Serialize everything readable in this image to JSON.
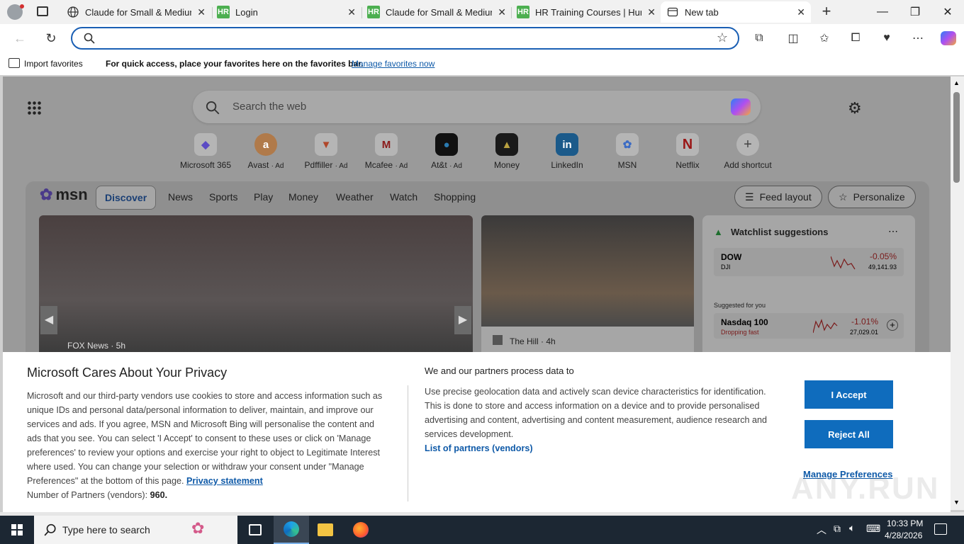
{
  "tabs": [
    {
      "title": "Claude for Small & Medium",
      "favicon": "globe-icon"
    },
    {
      "title": "Login",
      "favicon": "HR"
    },
    {
      "title": "Claude for Small & Medium",
      "favicon": "HR"
    },
    {
      "title": "HR Training Courses | Huma",
      "favicon": "HR"
    },
    {
      "title": "New tab",
      "favicon": "newtab-icon"
    }
  ],
  "address": {
    "value": "",
    "placeholder": ""
  },
  "favbar": {
    "import": "Import favorites",
    "message": "For quick access, place your favorites here on the favorites bar.",
    "manage_link": "Manage favorites now"
  },
  "newtab": {
    "search_placeholder": "Search the web",
    "shortcuts": [
      {
        "label": "Microsoft 365",
        "ad": ""
      },
      {
        "label": "Avast",
        "ad": "· Ad"
      },
      {
        "label": "Pdffiller",
        "ad": "· Ad"
      },
      {
        "label": "Mcafee",
        "ad": "· Ad"
      },
      {
        "label": "At&t",
        "ad": "· Ad"
      },
      {
        "label": "Money",
        "ad": ""
      },
      {
        "label": "LinkedIn",
        "ad": ""
      },
      {
        "label": "MSN",
        "ad": ""
      },
      {
        "label": "Netflix",
        "ad": ""
      },
      {
        "label": "Add shortcut",
        "ad": ""
      }
    ],
    "msn_logo": "msn",
    "nav": [
      "Discover",
      "News",
      "Sports",
      "Play",
      "Money",
      "Weather",
      "Watch",
      "Shopping"
    ],
    "feed_layout": "Feed layout",
    "personalize": "Personalize",
    "story1_source": "FOX News · 5h",
    "story2_source": "The Hill · 4h",
    "watchlist": {
      "title": "Watchlist suggestions",
      "items": [
        {
          "name": "DOW",
          "sub": "DJI",
          "change": "-0.05%",
          "value": "49,141.93"
        }
      ],
      "suggested_label": "Suggested for you",
      "suggested": [
        {
          "name": "Nasdaq 100",
          "sub": "Dropping fast",
          "change": "-1.01%",
          "value": "27,029.01"
        }
      ]
    }
  },
  "privacy": {
    "title": "Microsoft Cares About Your Privacy",
    "body": "Microsoft and our third-party vendors use cookies to store and access information such as unique IDs and personal data/personal information to deliver, maintain, and improve our services and ads. If you agree, MSN and Microsoft Bing will personalise the content and ads that you see. You can select 'I Accept' to consent to these uses or click on 'Manage preferences' to review your options and exercise your right to object to Legitimate Interest where used. You can change your selection or withdraw your consent under \"Manage Preferences\" at the bottom of this page.",
    "privacy_link": "Privacy statement",
    "partners_label": "Number of Partners (vendors):",
    "partners_count": "960.",
    "right_title": "We and our partners process data to",
    "right_body": "Use precise geolocation data and actively scan device characteristics for identification. This is done to store and access information on a device and to provide personalised advertising and content, advertising and content measurement, audience research and services development.",
    "vendors_link": "List of partners (vendors)",
    "accept": "I Accept",
    "reject": "Reject All",
    "manage": "Manage Preferences"
  },
  "taskbar": {
    "search_placeholder": "Type here to search",
    "time": "10:33 PM",
    "date": "4/28/2026"
  },
  "watermark": "ANY.RUN"
}
